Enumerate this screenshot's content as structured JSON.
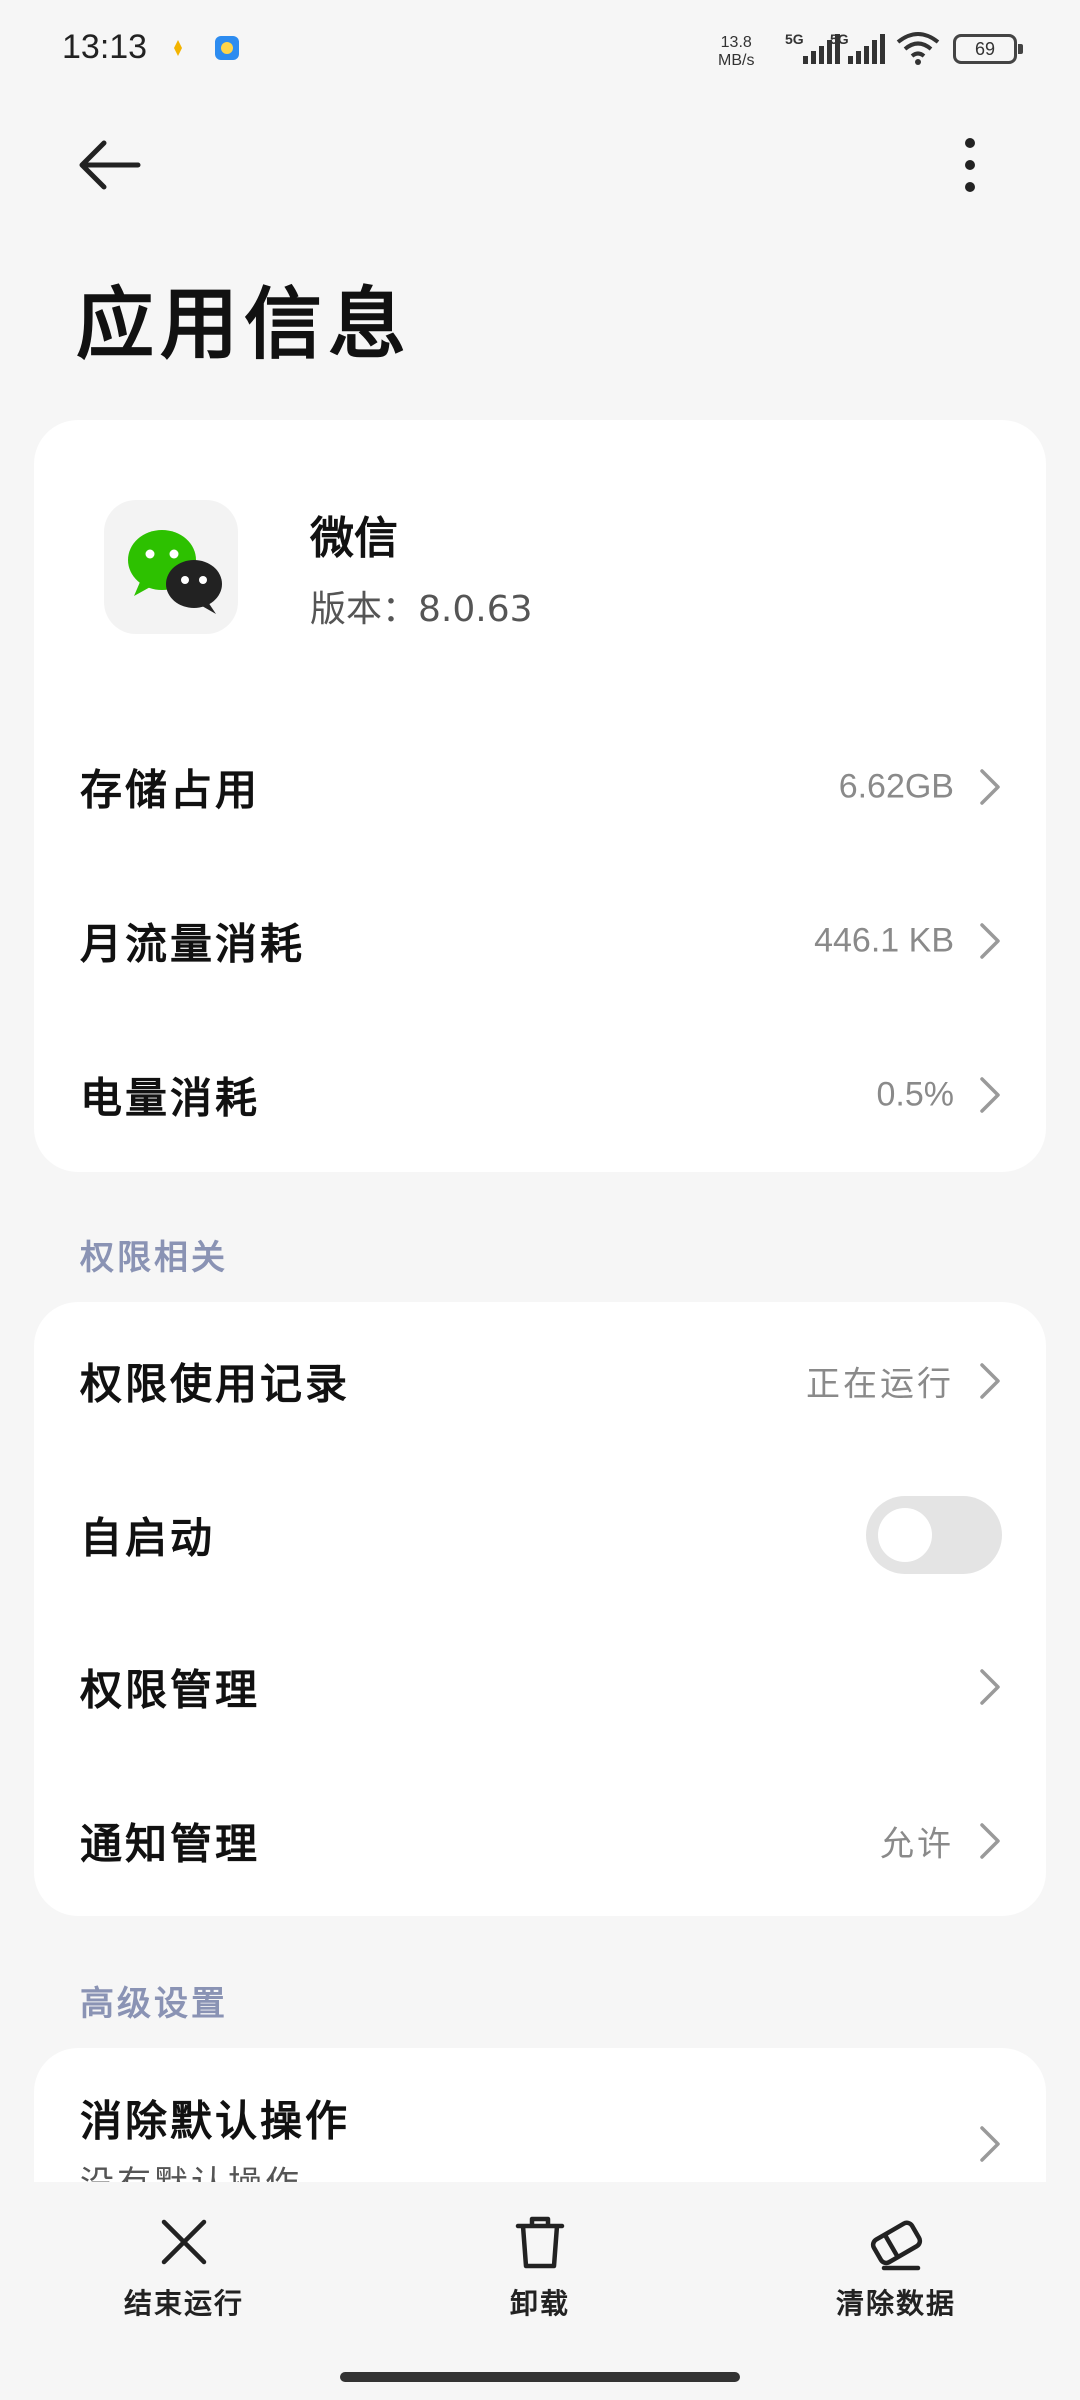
{
  "status_bar": {
    "time": "13:13",
    "net_speed_value": "13.8",
    "net_speed_unit": "MB/s",
    "signal1_label": "5G",
    "signal2_label": "5G",
    "battery": "69"
  },
  "header": {
    "title": "应用信息"
  },
  "app": {
    "name": "微信",
    "version": "版本：8.0.63"
  },
  "usage": [
    {
      "label": "存储占用",
      "value": "6.62GB"
    },
    {
      "label": "月流量消耗",
      "value": "446.1 KB"
    },
    {
      "label": "电量消耗",
      "value": "0.5%"
    }
  ],
  "permissions_section": {
    "title": "权限相关",
    "items": [
      {
        "label": "权限使用记录",
        "value": "正在运行"
      },
      {
        "label": "自启动",
        "toggle_on": false
      },
      {
        "label": "权限管理",
        "value": ""
      },
      {
        "label": "通知管理",
        "value": "允许"
      }
    ]
  },
  "advanced_section": {
    "title": "高级设置",
    "items": [
      {
        "label": "消除默认操作",
        "sublabel": "没有默认操作"
      }
    ]
  },
  "bottom_actions": [
    {
      "label": "结束运行",
      "icon": "close-icon"
    },
    {
      "label": "卸载",
      "icon": "trash-icon"
    },
    {
      "label": "清除数据",
      "icon": "eraser-icon"
    }
  ],
  "colors": {
    "background": "#f6f6f6",
    "card": "#ffffff",
    "section_label": "#8a93b4",
    "secondary_text": "#8a8a8a",
    "wechat_green": "#2dc100"
  }
}
